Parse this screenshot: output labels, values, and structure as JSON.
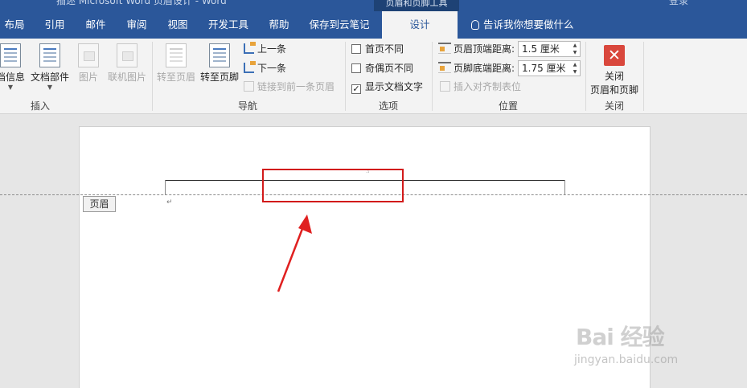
{
  "window": {
    "title": "插述 Microsoft Word 页眉设计 - Word",
    "context_title": "页眉和页脚工具",
    "right_text": "登录"
  },
  "tabs": [
    {
      "label": "布局",
      "active": false
    },
    {
      "label": "引用",
      "active": false
    },
    {
      "label": "邮件",
      "active": false
    },
    {
      "label": "审阅",
      "active": false
    },
    {
      "label": "视图",
      "active": false
    },
    {
      "label": "开发工具",
      "active": false
    },
    {
      "label": "帮助",
      "active": false
    },
    {
      "label": "保存到云笔记",
      "active": false
    },
    {
      "label": "设计",
      "active": true
    }
  ],
  "tell_me": "告诉我你想要做什么",
  "ribbon": {
    "insert": {
      "label": "插入",
      "doc_info": "档信息",
      "doc_parts": "文档部件",
      "picture": "图片",
      "online_picture": "联机图片"
    },
    "navigation": {
      "label": "导航",
      "goto_header": "转至页眉",
      "goto_footer": "转至页脚",
      "previous": "上一条",
      "next": "下一条",
      "link_previous": "链接到前一条页眉"
    },
    "options": {
      "label": "选项",
      "different_first": "首页不同",
      "different_odd_even": "奇偶页不同",
      "show_doc_text": "显示文档文字",
      "different_first_checked": false,
      "different_odd_even_checked": false,
      "show_doc_text_checked": true
    },
    "position": {
      "label": "位置",
      "header_top_label": "页眉顶端距离:",
      "header_top_value": "1.5 厘米",
      "footer_bottom_label": "页脚底端距离:",
      "footer_bottom_value": "1.75 厘米",
      "insert_align_tab": "插入对齐制表位"
    },
    "close": {
      "label": "关闭",
      "button_line1": "关闭",
      "button_line2": "页眉和页脚"
    }
  },
  "document": {
    "header_tag": "页眉",
    "paragraph_mark": "↵",
    "cursor_mark": "·¹"
  },
  "annotation": {
    "box_color": "#d21a1a",
    "arrow_color": "#e02020"
  },
  "watermark": {
    "text": "Bai 经验",
    "url": "jingyan.baidu.com"
  },
  "colors": {
    "titlebar": "#2b579a",
    "ribbon": "#f3f3f3",
    "workspace": "#e6e6e6"
  }
}
